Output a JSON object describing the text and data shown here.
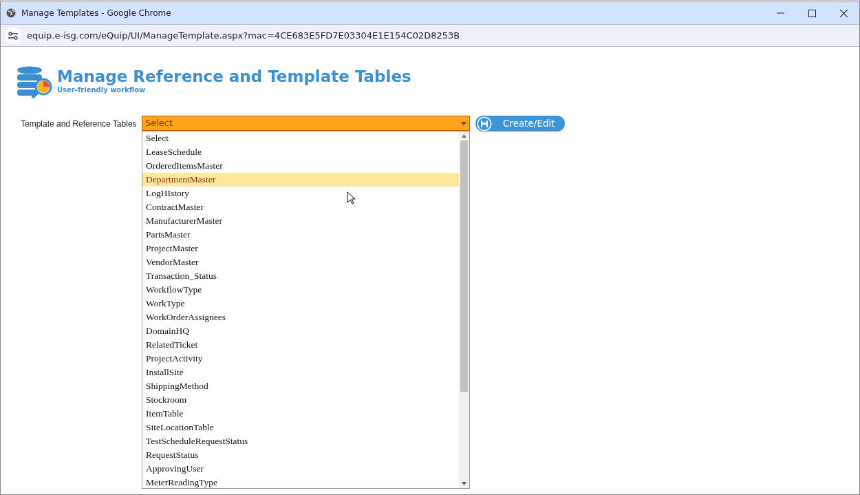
{
  "window": {
    "title": "Manage Templates - Google Chrome"
  },
  "address_bar": {
    "url": "equip.e-isg.com/eQuip/UI/ManageTemplate.aspx?mac=4CE683E5FD7E03304E1E154C02D8253B"
  },
  "header": {
    "title": "Manage Reference and Template Tables",
    "subtitle": "User-friendly workflow"
  },
  "form": {
    "label": "Template and Reference Tables",
    "value": "Select",
    "button": "Create/Edit"
  },
  "options": [
    {
      "label": "Select",
      "selected": false
    },
    {
      "label": "LeaseSchedule",
      "selected": false
    },
    {
      "label": "OrderedItemsMaster",
      "selected": false
    },
    {
      "label": "DepartmentMaster",
      "selected": true
    },
    {
      "label": "LogHIstory",
      "selected": false
    },
    {
      "label": "ContractMaster",
      "selected": false
    },
    {
      "label": "ManufacturerMaster",
      "selected": false
    },
    {
      "label": "PartsMaster",
      "selected": false
    },
    {
      "label": "ProjectMaster",
      "selected": false
    },
    {
      "label": "VendorMaster",
      "selected": false
    },
    {
      "label": "Transaction_Status",
      "selected": false
    },
    {
      "label": "WorkflowType",
      "selected": false
    },
    {
      "label": "WorkType",
      "selected": false
    },
    {
      "label": "WorkOrderAssignees",
      "selected": false
    },
    {
      "label": "DomainHQ",
      "selected": false
    },
    {
      "label": "RelatedTicket",
      "selected": false
    },
    {
      "label": "ProjectActivity",
      "selected": false
    },
    {
      "label": "InstallSite",
      "selected": false
    },
    {
      "label": "ShippingMethod",
      "selected": false
    },
    {
      "label": "Stockroom",
      "selected": false
    },
    {
      "label": "ItemTable",
      "selected": false
    },
    {
      "label": "SiteLocationTable",
      "selected": false
    },
    {
      "label": "TestScheduleRequestStatus",
      "selected": false
    },
    {
      "label": "RequestStatus",
      "selected": false
    },
    {
      "label": "ApprovingUser",
      "selected": false
    },
    {
      "label": "MeterReadingType",
      "selected": false
    }
  ]
}
